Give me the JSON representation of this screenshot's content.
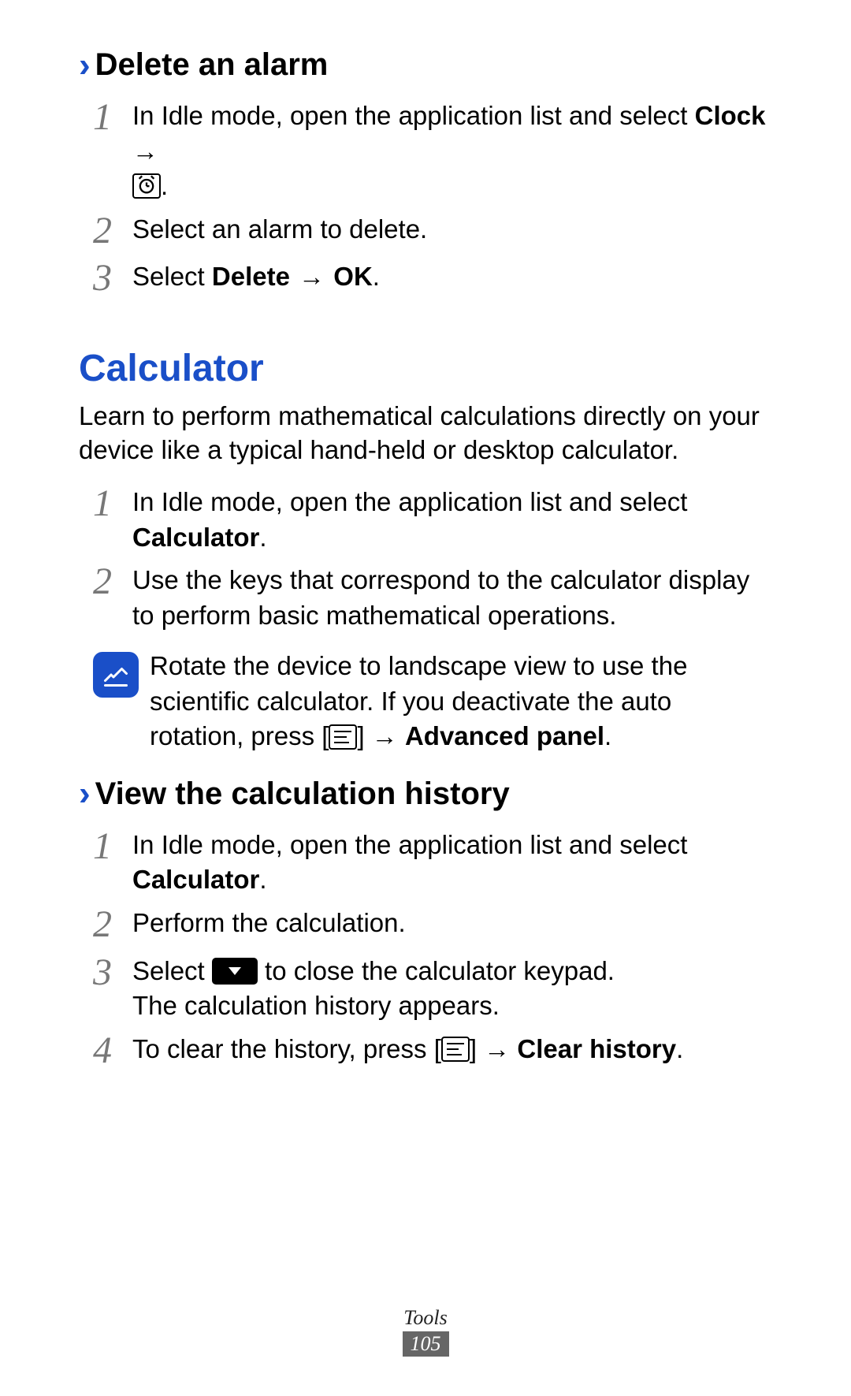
{
  "section_delete": {
    "heading": "Delete an alarm",
    "steps": [
      {
        "num": "1",
        "pre": "In Idle mode, open the application list and select ",
        "bold1": "Clock",
        "arrow": " → ",
        "post": "."
      },
      {
        "num": "2",
        "text": "Select an alarm to delete."
      },
      {
        "num": "3",
        "pre": "Select ",
        "bold1": "Delete",
        "arrow": " → ",
        "bold2": "OK",
        "post": "."
      }
    ]
  },
  "section_calc": {
    "title": "Calculator",
    "intro": "Learn to perform mathematical calculations directly on your device like a typical hand-held or desktop calculator.",
    "steps": [
      {
        "num": "1",
        "pre": "In Idle mode, open the application list and select ",
        "bold1": "Calculator",
        "post": "."
      },
      {
        "num": "2",
        "text": "Use the keys that correspond to the calculator display to perform basic mathematical operations."
      }
    ],
    "note": {
      "pre": "Rotate the device to landscape view to use the scientific calculator. If you deactivate the auto rotation, press [",
      "mid": "] → ",
      "bold": "Advanced panel",
      "post": "."
    }
  },
  "section_history": {
    "heading": "View the calculation history",
    "steps": [
      {
        "num": "1",
        "pre": "In Idle mode, open the application list and select ",
        "bold1": "Calculator",
        "post": "."
      },
      {
        "num": "2",
        "text": "Perform the calculation."
      },
      {
        "num": "3",
        "pre": "Select ",
        "mid": " to close the calculator keypad.",
        "line2": "The calculation history appears."
      },
      {
        "num": "4",
        "pre": "To clear the history, press [",
        "mid": "] → ",
        "bold1": "Clear history",
        "post": "."
      }
    ]
  },
  "footer": {
    "label": "Tools",
    "page": "105"
  }
}
